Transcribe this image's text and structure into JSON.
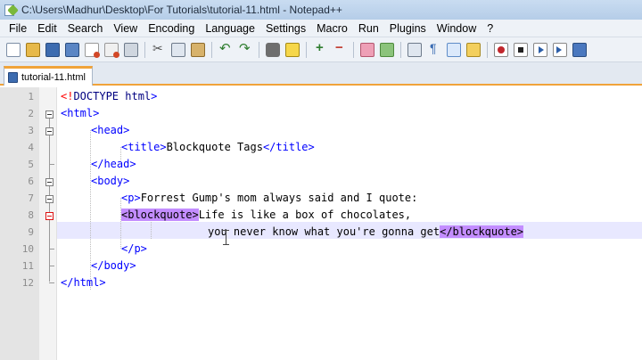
{
  "window": {
    "title": "C:\\Users\\Madhur\\Desktop\\For Tutorials\\tutorial-11.html - Notepad++"
  },
  "menu": [
    "File",
    "Edit",
    "Search",
    "View",
    "Encoding",
    "Language",
    "Settings",
    "Macro",
    "Run",
    "Plugins",
    "Window",
    "?"
  ],
  "toolbar_icons": [
    "new-file-icon",
    "open-file-icon",
    "save-icon",
    "save-all-icon",
    "close-icon",
    "close-all-icon",
    "print-icon",
    "cut-icon",
    "copy-icon",
    "paste-icon",
    "undo-icon",
    "redo-icon",
    "find-icon",
    "replace-icon",
    "zoom-in-icon",
    "zoom-out-icon",
    "sync-vertical-icon",
    "sync-horizontal-icon",
    "word-wrap-icon",
    "show-all-chars-icon",
    "indent-guide-icon",
    "user-defined-language-icon",
    "record-macro-icon",
    "stop-macro-icon",
    "play-macro-icon",
    "play-macro-multiple-icon",
    "save-macro-icon"
  ],
  "tabs": [
    {
      "label": "tutorial-11.html",
      "active": true
    }
  ],
  "editor": {
    "line_numbers": [
      "1",
      "2",
      "3",
      "4",
      "5",
      "6",
      "7",
      "8",
      "9",
      "10",
      "11",
      "12"
    ],
    "current_line": "9",
    "lines": {
      "l1": {
        "open": "<!",
        "doctype": "DOCTYPE html",
        "close": ">"
      },
      "l2": {
        "tag": "<html>"
      },
      "l3": {
        "tag": "<head>"
      },
      "l4": {
        "open": "<title>",
        "text": "Blockquote Tags",
        "close": "</title>"
      },
      "l5": {
        "tag": "</head>"
      },
      "l6": {
        "tag": "<body>"
      },
      "l7": {
        "open": "<p>",
        "text": "Forrest Gump's mom always said and I quote:"
      },
      "l8": {
        "open": "<blockquote>",
        "text": "Life is like a box of chocolates,"
      },
      "l9": {
        "text": "you never know what you're gonna get",
        "close": "</blockquote>"
      },
      "l10": {
        "tag": "</p>"
      },
      "l11": {
        "tag": "</body>"
      },
      "l12": {
        "tag": "</html>"
      }
    }
  },
  "colors": {
    "tag": "#0000ff",
    "tag_match_highlight": "#c38dff",
    "current_line": "#e8e8ff",
    "active_tab_accent": "#f0a33a"
  }
}
